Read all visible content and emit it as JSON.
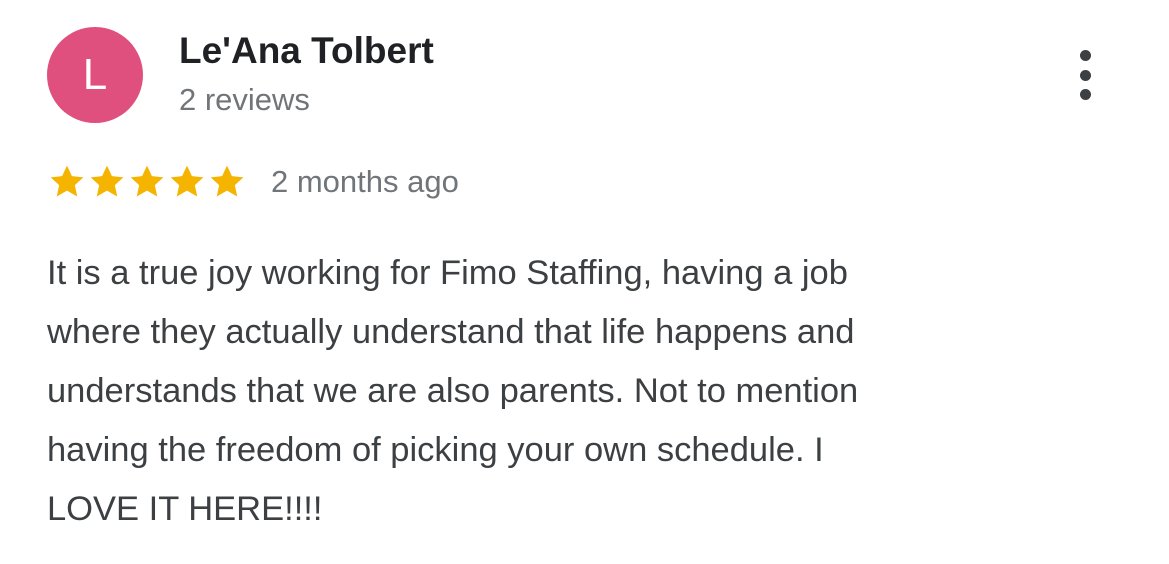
{
  "colors": {
    "avatar_bg": "#e0507e",
    "star": "#f4b400"
  },
  "author": {
    "avatar_letter": "L",
    "name": "Le'Ana Tolbert",
    "review_count": "2 reviews"
  },
  "menu": {
    "icon": "more-vertical-icon"
  },
  "review": {
    "rating": 5,
    "rating_max": 5,
    "date": "2 months ago",
    "lines": [
      "It is a true joy working for Fimo Staffing, having a job",
      "where they actually understand that life happens and",
      "understands that we are also parents. Not to mention",
      "having the freedom of picking your own schedule. I",
      "LOVE IT HERE!!!!"
    ]
  }
}
